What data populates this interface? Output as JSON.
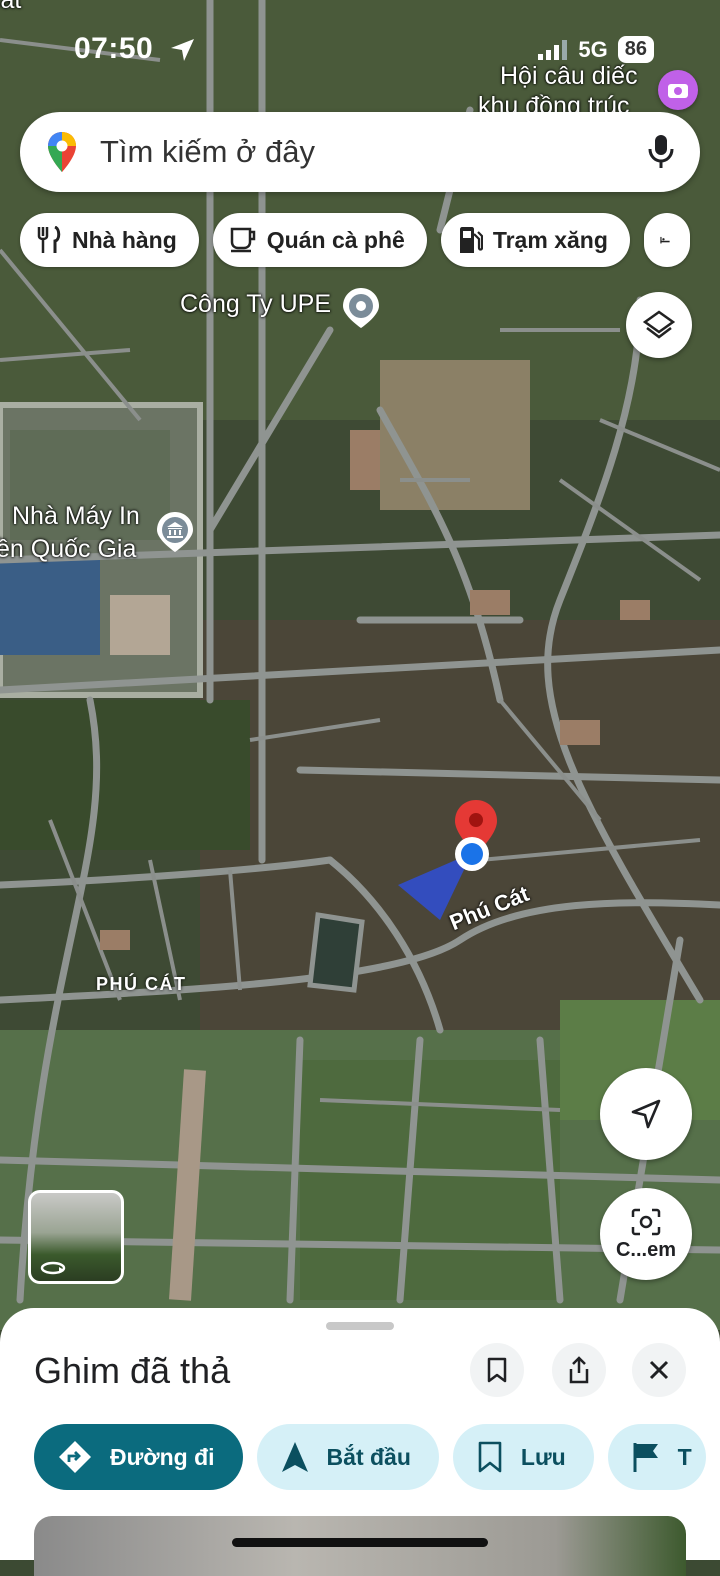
{
  "status": {
    "time": "07:50",
    "network": "5G",
    "battery": "86"
  },
  "search": {
    "placeholder": "Tìm kiếm ở đây"
  },
  "chips": [
    {
      "label": "Nhà hàng",
      "icon": "fork-knife-icon"
    },
    {
      "label": "Quán cà phê",
      "icon": "coffee-cup-icon"
    },
    {
      "label": "Trạm xăng",
      "icon": "gas-pump-icon"
    }
  ],
  "map": {
    "labels": {
      "top_left": "cát",
      "hoi_line1": "Hội câu diếc",
      "hoi_line2": "khu đồng trúc",
      "upe": "Công Ty UPE",
      "nha_may_line1": "Nhà Máy In",
      "nha_may_line2": "ền Quốc Gia",
      "road": "Phú Cát",
      "area": "PHÚ CÁT"
    },
    "colors": {
      "pin": "#e53935",
      "location_dot": "#1a73e8",
      "road": "#8f9491",
      "field": "#4d6a3d"
    }
  },
  "fabs": {
    "camera_label": "C...em"
  },
  "sheet": {
    "title": "Ghim đã thả",
    "actions": [
      {
        "label": "Đường đi",
        "icon": "directions-icon"
      },
      {
        "label": "Bắt đầu",
        "icon": "navigation-arrow-icon"
      },
      {
        "label": "Lưu",
        "icon": "bookmark-icon"
      },
      {
        "label": "T",
        "icon": "flag-icon"
      }
    ]
  }
}
